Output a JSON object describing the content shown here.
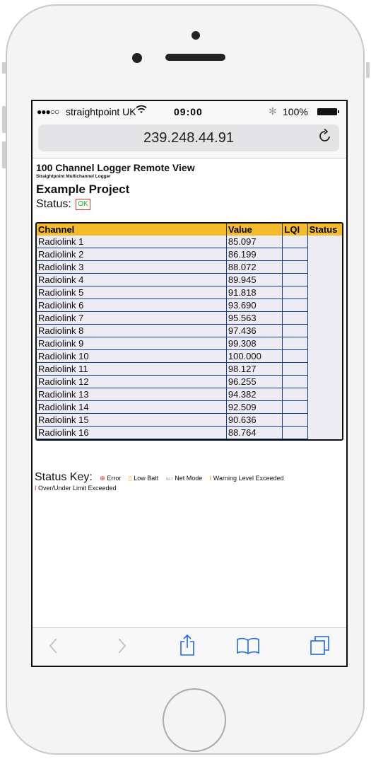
{
  "statusbar": {
    "signal": "●●●○○",
    "carrier": "straightpoint UK",
    "wifi_icon": "wifi-icon",
    "time": "09:00",
    "bluetooth_icon": "bluetooth-icon",
    "battery_pct": "100%"
  },
  "browser": {
    "url": "239.248.44.91",
    "reload_icon": "reload-icon"
  },
  "page": {
    "title": "100 Channel Logger Remote View",
    "subtitle": "Straightpoint Multichannel Logger",
    "project": "Example Project",
    "status_label": "Status:",
    "status_value": "OK"
  },
  "table": {
    "headers": [
      "Channel",
      "Value",
      "LQI",
      "Status"
    ],
    "rows": [
      {
        "channel": "Radiolink 1",
        "value": "85.097"
      },
      {
        "channel": "Radiolink 2",
        "value": "86.199"
      },
      {
        "channel": "Radiolink 3",
        "value": "88.072"
      },
      {
        "channel": "Radiolink 4",
        "value": "89.945"
      },
      {
        "channel": "Radiolink 5",
        "value": "91.818"
      },
      {
        "channel": "Radiolink 6",
        "value": "93.690"
      },
      {
        "channel": "Radiolink 7",
        "value": "95.563"
      },
      {
        "channel": "Radiolink 8",
        "value": "97.436"
      },
      {
        "channel": "Radiolink 9",
        "value": "99.308"
      },
      {
        "channel": "Radiolink 10",
        "value": "100.000"
      },
      {
        "channel": "Radiolink 11",
        "value": "98.127"
      },
      {
        "channel": "Radiolink 12",
        "value": "96.255"
      },
      {
        "channel": "Radiolink 13",
        "value": "94.382"
      },
      {
        "channel": "Radiolink 14",
        "value": "92.509"
      },
      {
        "channel": "Radiolink 15",
        "value": "90.636"
      },
      {
        "channel": "Radiolink 16",
        "value": "88.764"
      }
    ]
  },
  "status_key": {
    "title": "Status Key:",
    "items": [
      {
        "icon": "error-icon",
        "label": "Error",
        "color": "#e02020"
      },
      {
        "icon": "low-batt-icon",
        "label": "Low Batt",
        "color": "#f0b000"
      },
      {
        "icon": "net-mode-icon",
        "label": "Net Mode",
        "color": "#999999"
      },
      {
        "icon": "warning-icon",
        "label": "Warning Level Exceeded",
        "color": "#f08000"
      },
      {
        "icon": "limit-icon",
        "label": "Over/Under Limit Exceeded",
        "color": "#e02020"
      }
    ]
  },
  "toolbar": {
    "back_icon": "back-icon",
    "forward_icon": "forward-icon",
    "share_icon": "share-icon",
    "bookmarks_icon": "bookmarks-icon",
    "tabs_icon": "tabs-icon"
  },
  "colors": {
    "header_bg": "#f4bb2a",
    "row_bg": "#ececf2",
    "grid": "#1a3a8a",
    "link_blue": "#1f6ae0"
  }
}
